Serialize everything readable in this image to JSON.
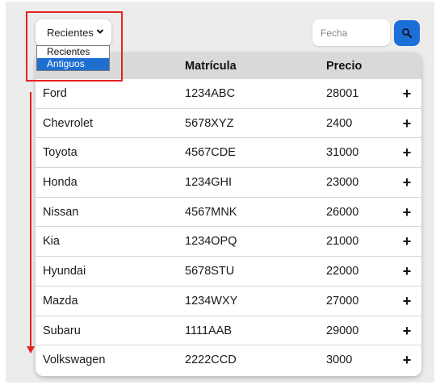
{
  "sort": {
    "selected_label": "Recientes",
    "options": [
      {
        "label": "Recientes",
        "selected": false
      },
      {
        "label": "Antiguos",
        "selected": true
      }
    ]
  },
  "search": {
    "placeholder": "Fecha",
    "button_icon": "search-icon"
  },
  "table": {
    "headers": [
      "",
      "Matrícula",
      "Precio",
      ""
    ],
    "add_symbol": "+",
    "rows": [
      {
        "brand": "Ford",
        "plate": "1234ABC",
        "price": "28001"
      },
      {
        "brand": "Chevrolet",
        "plate": "5678XYZ",
        "price": "2400"
      },
      {
        "brand": "Toyota",
        "plate": "4567CDE",
        "price": "31000"
      },
      {
        "brand": "Honda",
        "plate": "1234GHI",
        "price": "23000"
      },
      {
        "brand": "Nissan",
        "plate": "4567MNK",
        "price": "26000"
      },
      {
        "brand": "Kia",
        "plate": "1234OPQ",
        "price": "21000"
      },
      {
        "brand": "Hyundai",
        "plate": "5678STU",
        "price": "22000"
      },
      {
        "brand": "Mazda",
        "plate": "1234WXY",
        "price": "27000"
      },
      {
        "brand": "Subaru",
        "plate": "1111AAB",
        "price": "29000"
      },
      {
        "brand": "Volkswagen",
        "plate": "2222CCD",
        "price": "3000"
      }
    ]
  },
  "colors": {
    "accent": "#1d6fd8",
    "annotation": "#e32222",
    "header_bg": "#d9d9d9"
  }
}
